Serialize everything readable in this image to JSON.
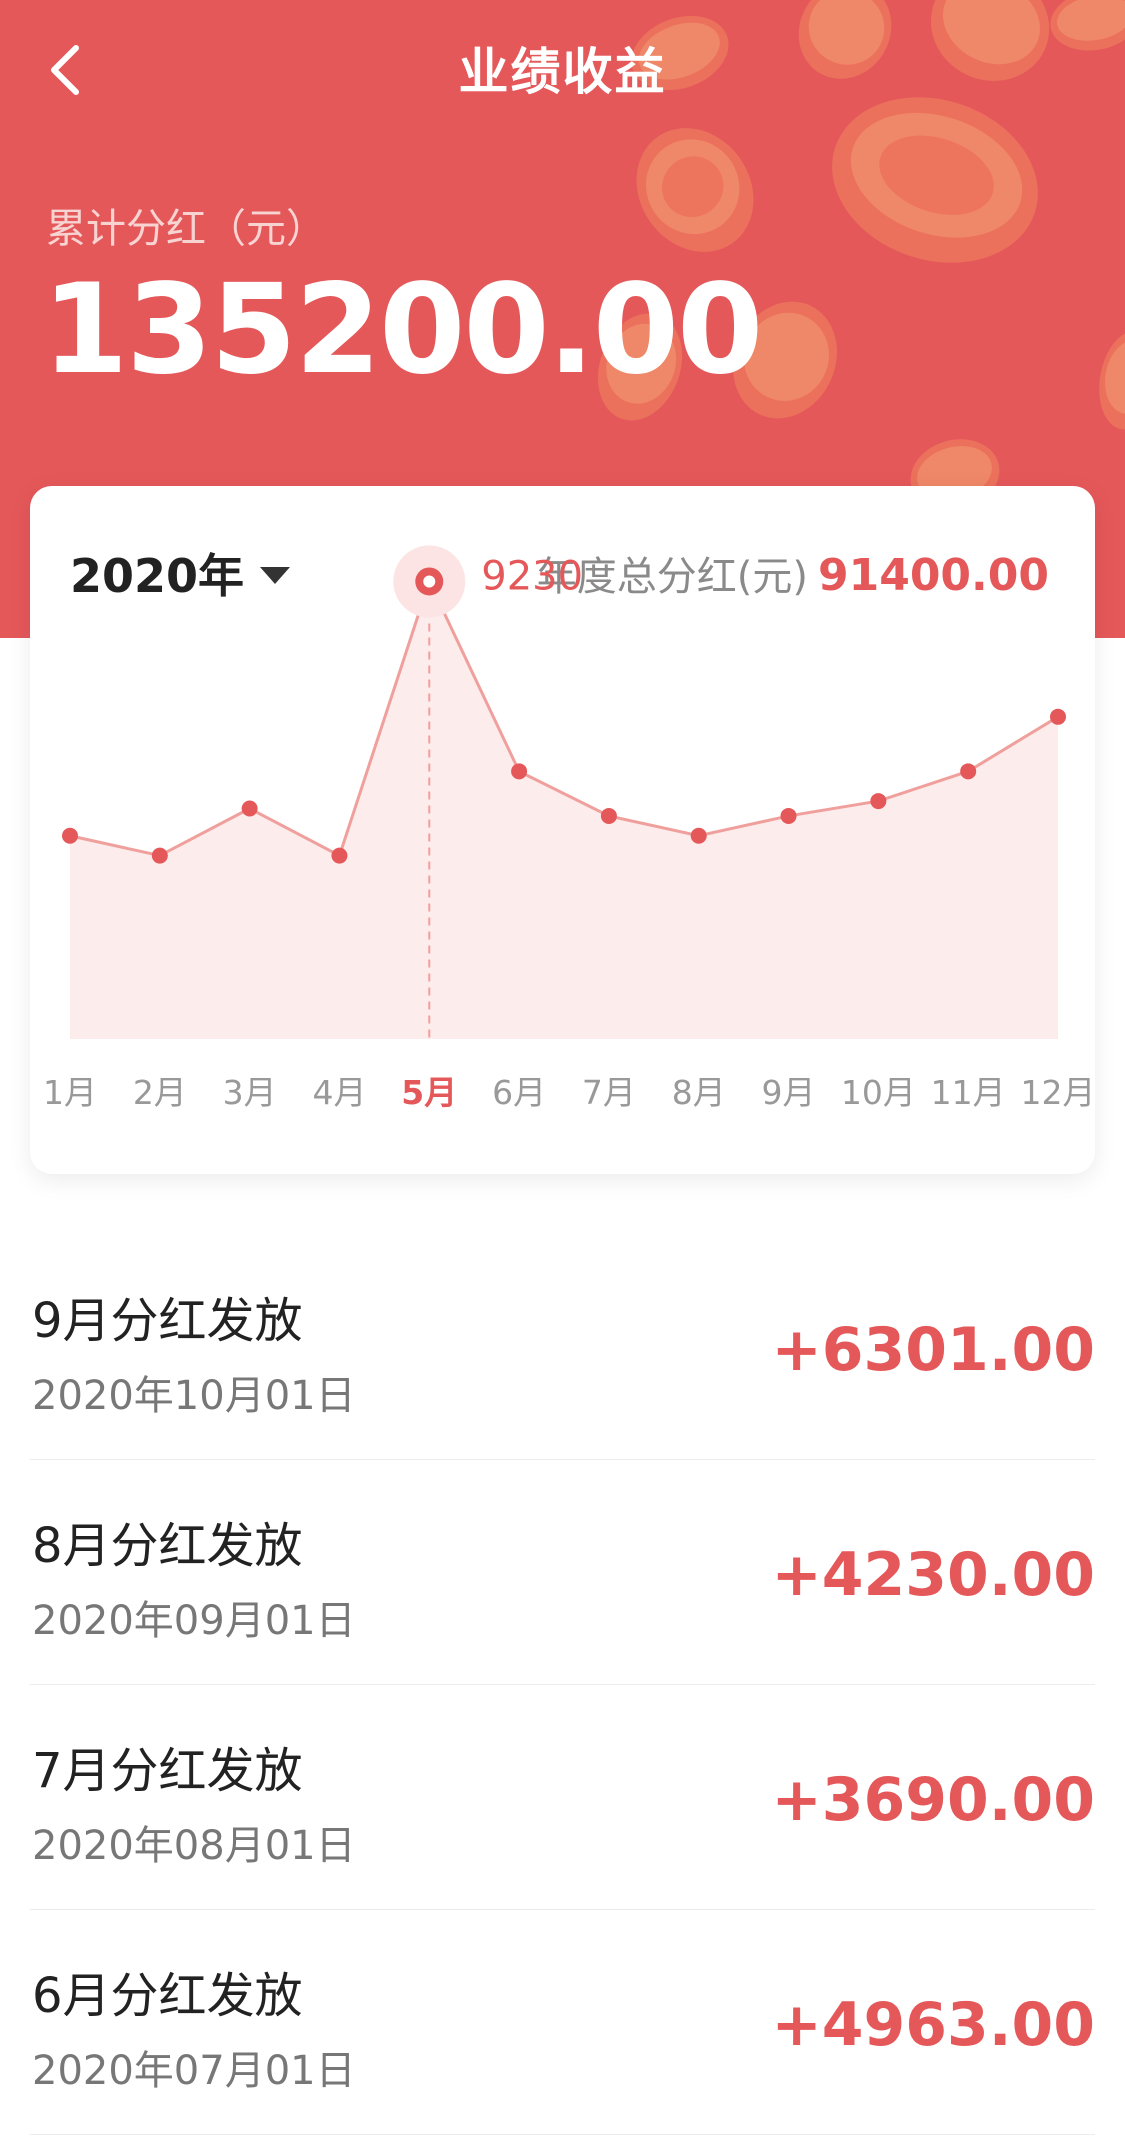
{
  "header": {
    "title": "业绩收益",
    "cumulative_label": "累计分红（元）",
    "cumulative_value": "135200.00",
    "background_color": "#e5585a"
  },
  "card": {
    "year_label": "2020年",
    "annual_label": "年度总分红(元)",
    "annual_value": "91400.00"
  },
  "chart_data": {
    "type": "area",
    "categories": [
      "1月",
      "2月",
      "3月",
      "4月",
      "5月",
      "6月",
      "7月",
      "8月",
      "9月",
      "10月",
      "11月",
      "12月"
    ],
    "values": [
      4100,
      3700,
      4650,
      3700,
      9230,
      5400,
      4500,
      4100,
      4500,
      4800,
      5400,
      6500
    ],
    "highlighted_index": 4,
    "highlight_label": "9230",
    "line_color": "#f0a09c",
    "point_color": "#e5585a",
    "fill_color": "#fdecec",
    "ylim": [
      0,
      10000
    ],
    "grid": false
  },
  "records": [
    {
      "title": "9月分红发放",
      "date": "2020年10月01日",
      "amount": "+6301.00"
    },
    {
      "title": "8月分红发放",
      "date": "2020年09月01日",
      "amount": "+4230.00"
    },
    {
      "title": "7月分红发放",
      "date": "2020年08月01日",
      "amount": "+3690.00"
    },
    {
      "title": "6月分红发放",
      "date": "2020年07月01日",
      "amount": "+4963.00"
    }
  ]
}
